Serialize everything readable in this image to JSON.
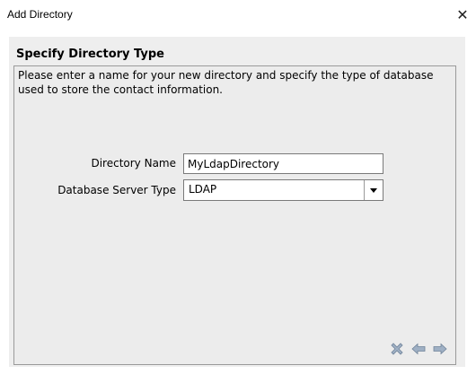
{
  "window": {
    "title": "Add Directory",
    "close_glyph": "✕"
  },
  "wizard": {
    "step_heading": "Specify Directory Type",
    "description": "Please enter a name for your new directory and specify the type of database used to store the contact information."
  },
  "form": {
    "directory_name_label": "Directory Name",
    "directory_name_value": "MyLdapDirectory",
    "db_server_type_label": "Database Server Type",
    "db_server_type_value": "LDAP"
  },
  "nav": {
    "icons": [
      "cancel-icon",
      "back-arrow-icon",
      "next-arrow-icon"
    ],
    "icon_color": "#8aa0b8"
  }
}
